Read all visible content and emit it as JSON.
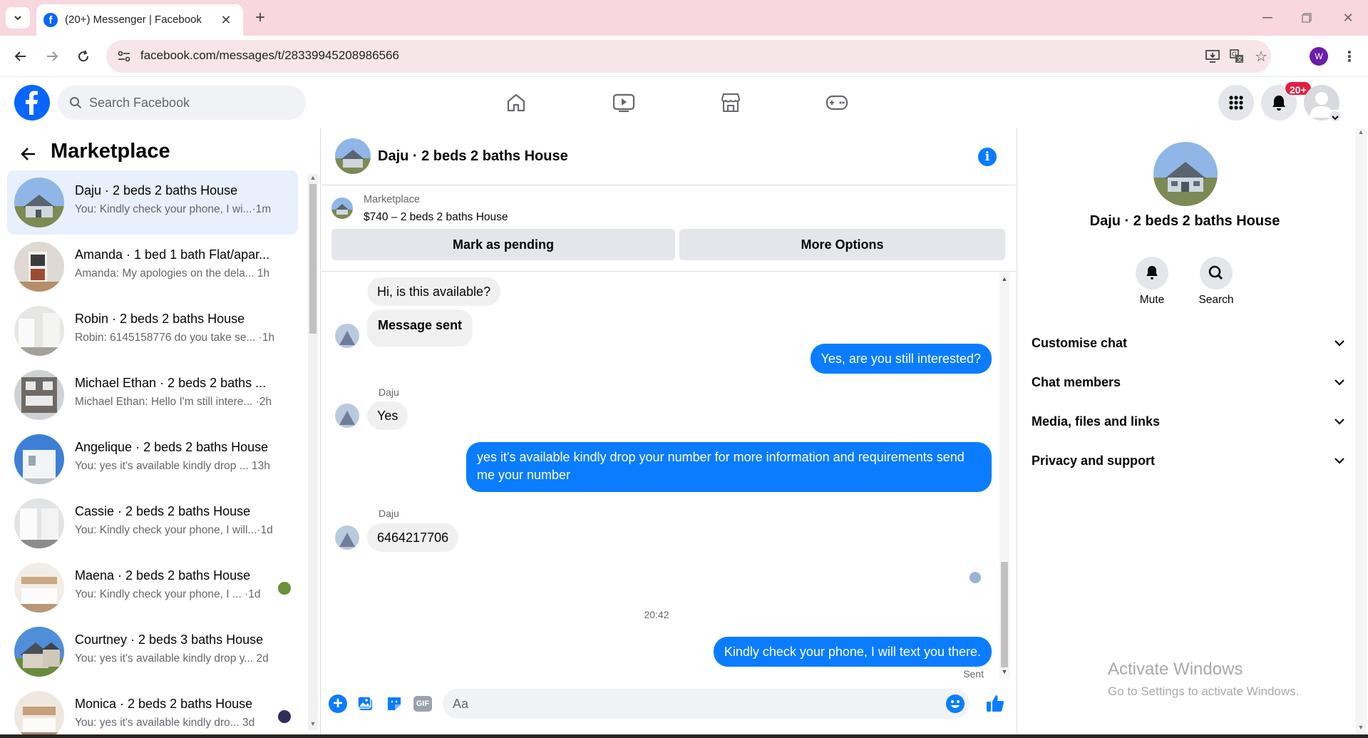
{
  "browser": {
    "tab_title": "(20+) Messenger | Facebook",
    "url": "facebook.com/messages/t/28339945208986566",
    "profile_initial": "W"
  },
  "fb": {
    "search_placeholder": "Search Facebook",
    "notification_badge": "20+"
  },
  "left": {
    "title": "Marketplace",
    "conversations": [
      {
        "name": "Daju · 2 beds 2 baths House",
        "preview": "You: Kindly check your phone, I wi...",
        "time": "·1m"
      },
      {
        "name": "Amanda · 1 bed 1 bath Flat/apar...",
        "preview": "Amanda: My apologies on the dela...",
        "time": "1h"
      },
      {
        "name": "Robin · 2 beds 2 baths House",
        "preview": "Robin: 6145158776 do you take se...",
        "time": "·1h"
      },
      {
        "name": "Michael Ethan · 2 beds 2 baths ...",
        "preview": "Michael Ethan: Hello I'm still intere...",
        "time": "·2h"
      },
      {
        "name": "Angelique · 2 beds 2 baths House",
        "preview": "You: yes it's available kindly drop ...",
        "time": "13h"
      },
      {
        "name": "Cassie · 2 beds 2 baths House",
        "preview": "You: Kindly check your phone, I will...",
        "time": "·1d"
      },
      {
        "name": "Maena · 2 beds 2 baths House",
        "preview": "You: Kindly check your phone, I ...",
        "time": "·1d"
      },
      {
        "name": "Courtney · 2 beds 3 baths House",
        "preview": "You: yes it's available kindly drop y...",
        "time": "2d"
      },
      {
        "name": "Monica · 2 beds 2 baths House",
        "preview": "You: yes it's available kindly dro...",
        "time": "3d"
      }
    ]
  },
  "chat": {
    "title": "Daju · 2 beds 2 baths House",
    "listing_label": "Marketplace",
    "listing_detail": "$740 – 2 beds 2 baths House",
    "btn_pending": "Mark as pending",
    "btn_more": "More Options",
    "msg1": "Hi, is this available?",
    "msg2": "Message sent",
    "msg3": "Yes, are you still interested?",
    "sender1": "Daju",
    "msg4": "Yes",
    "msg5": "yes it's available kindly drop your number for more information and requirements send me your number",
    "sender2": "Daju",
    "msg6": "6464217706",
    "timestamp": "20:42",
    "msg7": "Kindly check your phone, I will text you there.",
    "status": "Sent",
    "input_placeholder": "Aa"
  },
  "right": {
    "title": "Daju · 2 beds 2 baths House",
    "mute": "Mute",
    "search": "Search",
    "sections": [
      "Customise chat",
      "Chat members",
      "Media, files and links",
      "Privacy and support"
    ],
    "watermark_title": "Activate Windows",
    "watermark_sub": "Go to Settings to activate Windows."
  },
  "colors": {
    "accent": "#0a7cff",
    "fb_blue": "#0866ff",
    "badge_red": "#e41e3f"
  }
}
